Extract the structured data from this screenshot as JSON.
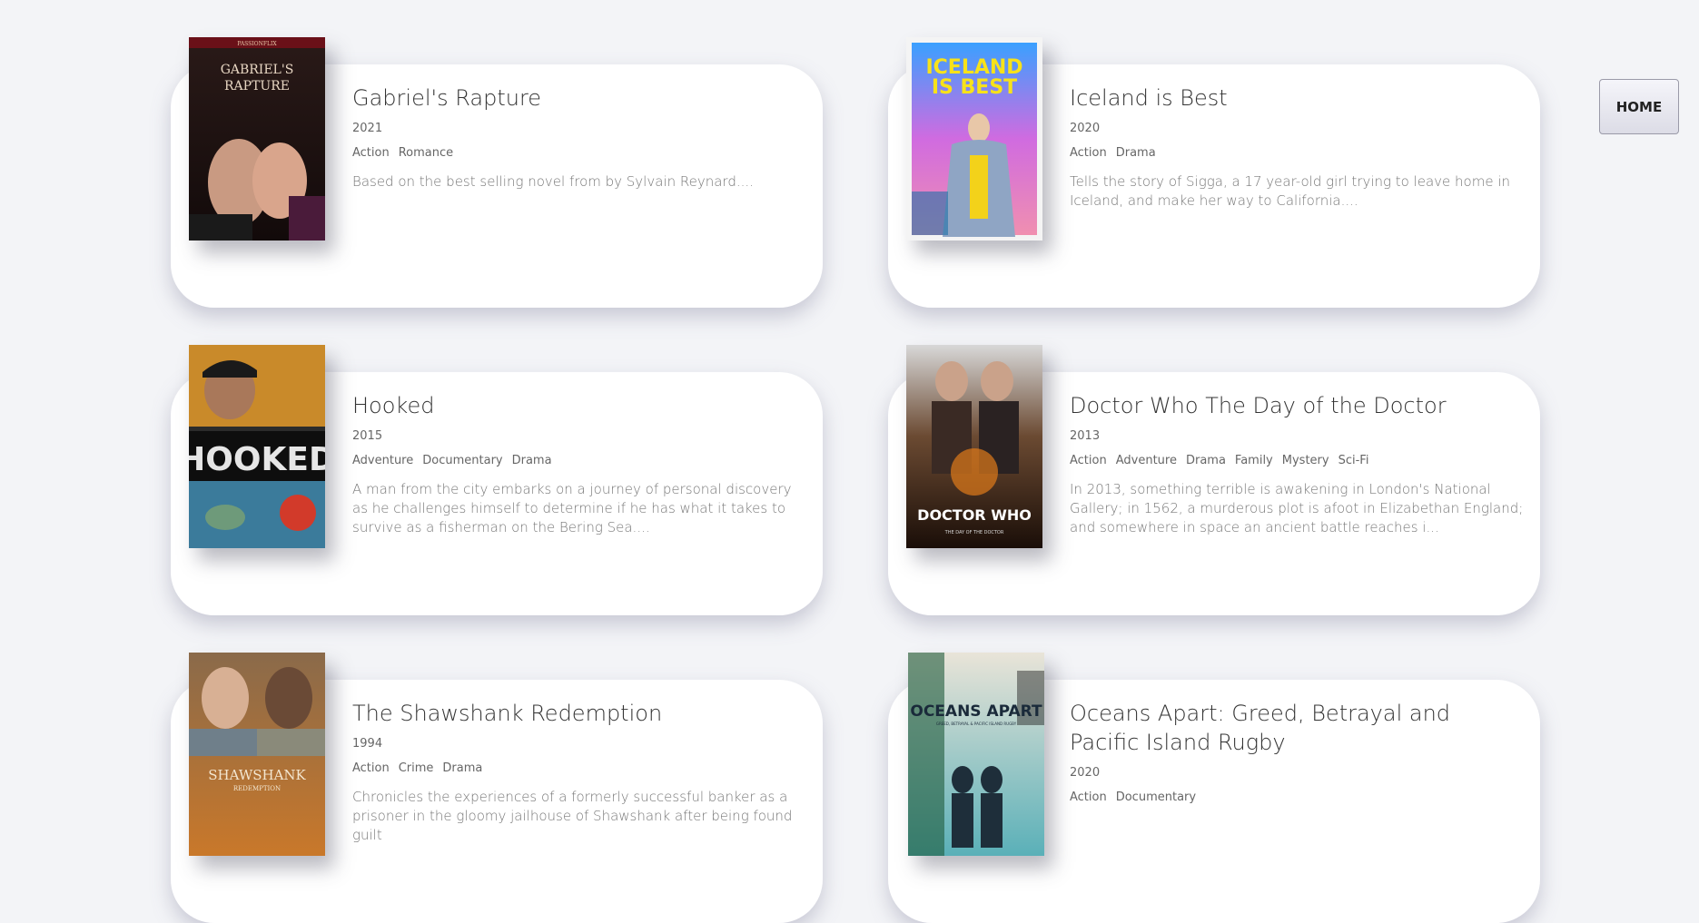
{
  "nav": {
    "home_label": "HOME"
  },
  "movies": [
    {
      "title": "Gabriel's Rapture",
      "year": "2021",
      "genres": [
        "Action",
        "Romance"
      ],
      "description": "Based on the best selling novel from by Sylvain Reynard....",
      "poster": {
        "top_text": "PASSIONFLIX",
        "title_text": "GABRIEL'S RAPTURE"
      }
    },
    {
      "title": "Iceland is Best",
      "year": "2020",
      "genres": [
        "Action",
        "Drama"
      ],
      "description": "Tells the story of Sigga, a 17 year-old girl trying to leave home in Iceland, and make her way to California....",
      "poster": {
        "title_text": "ICELAND IS BEST"
      }
    },
    {
      "title": "Hooked",
      "year": "2015",
      "genres": [
        "Adventure",
        "Documentary",
        "Drama"
      ],
      "description": "A man from the city embarks on a journey of personal discovery as he challenges himself to determine if he has what it takes to survive as a fisherman on the Bering Sea....",
      "poster": {
        "title_text": "HOOKED"
      }
    },
    {
      "title": "Doctor Who The Day of the Doctor",
      "year": "2013",
      "genres": [
        "Action",
        "Adventure",
        "Drama",
        "Family",
        "Mystery",
        "Sci-Fi"
      ],
      "description": "In 2013, something terrible is awakening in London's National Gallery; in 1562, a murderous plot is afoot in Elizabethan England; and somewhere in space an ancient battle reaches i...",
      "poster": {
        "title_text": "DOCTOR WHO",
        "sub_text": "THE DAY OF THE DOCTOR"
      }
    },
    {
      "title": "The Shawshank Redemption",
      "year": "1994",
      "genres": [
        "Action",
        "Crime",
        "Drama"
      ],
      "description": "Chronicles the experiences of a formerly successful banker as a prisoner in the gloomy jailhouse of Shawshank after being found guilt",
      "poster": {
        "title_text": "SHAWSHANK",
        "sub_text": "REDEMPTION"
      }
    },
    {
      "title": "Oceans Apart: Greed, Betrayal and Pacific Island Rugby",
      "year": "2020",
      "genres": [
        "Action",
        "Documentary"
      ],
      "description": "",
      "poster": {
        "title_text": "OCEANS APART",
        "sub_text": "GREED, BETRAYAL & PACIFIC ISLAND RUGBY"
      }
    }
  ]
}
